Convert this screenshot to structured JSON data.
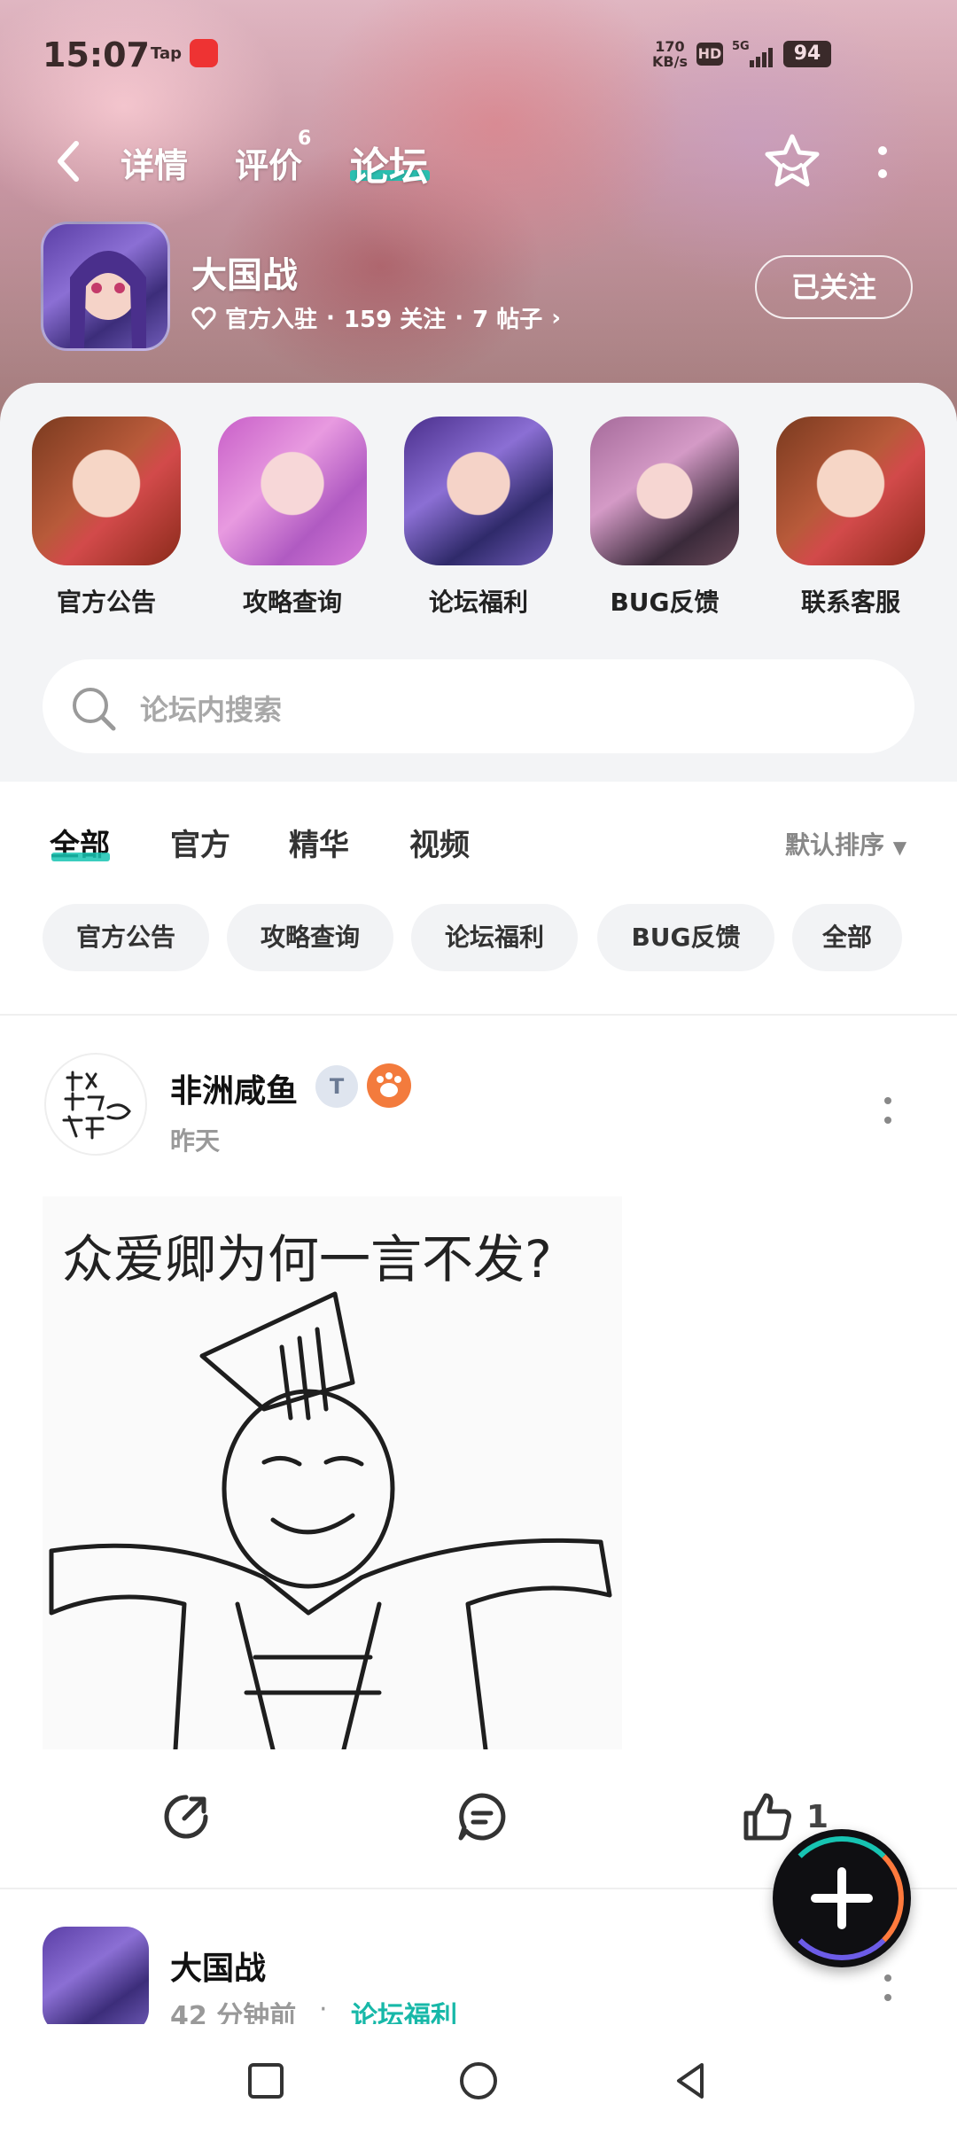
{
  "status_bar": {
    "time": "15:07",
    "tap_label": "Tap",
    "net_speed": "170\nKB/s",
    "hd": "HD",
    "signal": "5G",
    "battery": "94"
  },
  "nav": {
    "tabs": [
      {
        "label": "详情"
      },
      {
        "label": "评价",
        "badge": "6"
      },
      {
        "label": "论坛"
      }
    ],
    "active_tab": "论坛"
  },
  "game": {
    "title": "大国战",
    "official": "官方入驻",
    "followers": "159 关注",
    "posts": "7 帖子",
    "follow_label": "已关注"
  },
  "shortcuts": [
    {
      "label": "官方公告"
    },
    {
      "label": "攻略查询"
    },
    {
      "label": "论坛福利"
    },
    {
      "label": "BUG反馈"
    },
    {
      "label": "联系客服"
    }
  ],
  "search": {
    "placeholder": "论坛内搜索"
  },
  "filter_tabs": [
    {
      "label": "全部"
    },
    {
      "label": "官方"
    },
    {
      "label": "精华"
    },
    {
      "label": "视频"
    }
  ],
  "sort_label": "默认排序",
  "chips": [
    {
      "label": "官方公告"
    },
    {
      "label": "攻略查询"
    },
    {
      "label": "论坛福利"
    },
    {
      "label": "BUG反馈"
    },
    {
      "label": "全部"
    }
  ],
  "post1": {
    "author": "非洲咸鱼",
    "time": "昨天",
    "image_caption": "众爱卿为何一言不发?",
    "like_count": "1"
  },
  "post2": {
    "author": "大国战",
    "time": "42 分钟前",
    "tag": "论坛福利"
  },
  "colors": {
    "accent": "#18c4b3",
    "fab_bg": "#0f0f12"
  }
}
